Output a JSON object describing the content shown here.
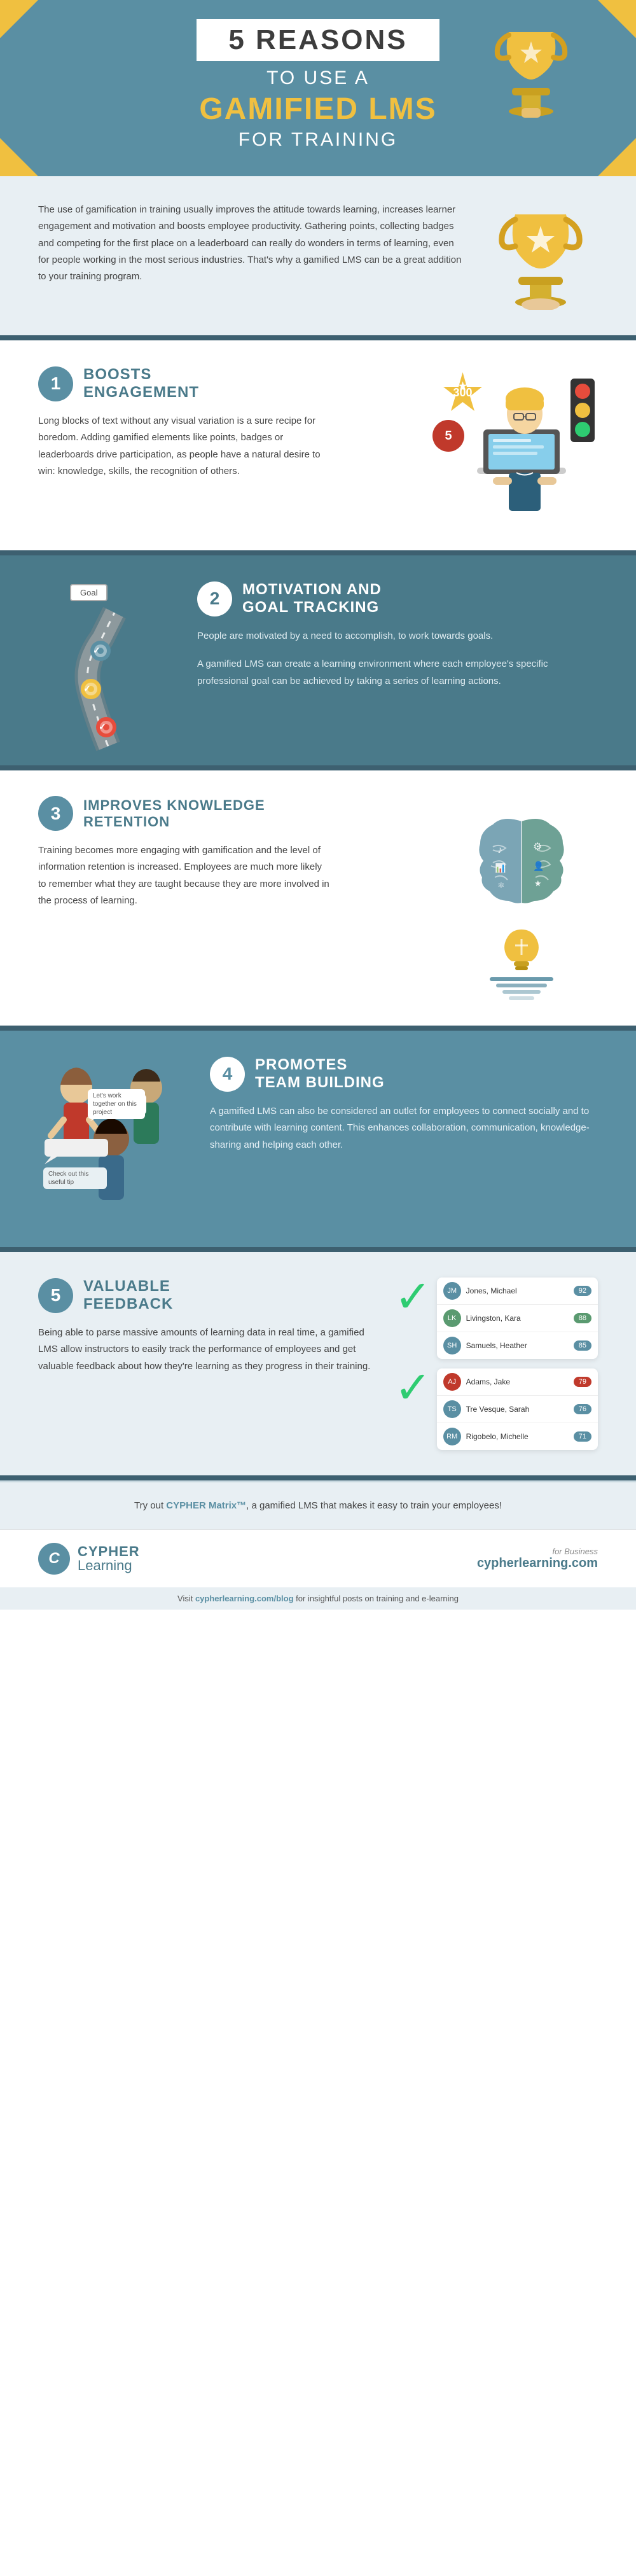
{
  "header": {
    "banner_text": "5 REASONS",
    "sub1": "TO USE A",
    "sub2": "GAMIFIED LMS",
    "sub3": "FOR TRAINING"
  },
  "intro": {
    "text": "The use of gamification in training usually improves the attitude towards learning, increases learner engagement and motivation and boosts employee productivity. Gathering points, collecting badges and competing for the first place on a leaderboard can really do wonders in terms of learning, even for people working in the most serious industries. That's why a gamified LMS can be a great addition to your training program."
  },
  "reasons": [
    {
      "number": "1",
      "title": "BOOSTS\nENGAGEMENT",
      "title_line1": "BOOSTS",
      "title_line2": "ENGAGEMENT",
      "body": "Long blocks of text without any visual variation is a sure recipe for boredom. Adding gamified elements like points, badges or leaderboards drive participation, as people have a natural desire to win: knowledge, skills, the recognition of others.",
      "badge_300": "300",
      "badge_5": "5"
    },
    {
      "number": "2",
      "title_line1": "MOTIVATION AND",
      "title_line2": "GOAL TRACKING",
      "body1": "People are motivated by a need to accomplish, to work towards goals.",
      "body2": "A gamified LMS can create a learning environment where each employee's specific professional goal can be achieved by taking a series of learning actions.",
      "goal_label": "Goal"
    },
    {
      "number": "3",
      "title_line1": "IMPROVES KNOWLEDGE",
      "title_line2": "RETENTION",
      "body": "Training becomes more engaging with gamification and the level of information retention is increased. Employees are much more likely to remember what they are taught because they are more involved in the process of learning."
    },
    {
      "number": "4",
      "title_line1": "PROMOTES",
      "title_line2": "TEAM BUILDING",
      "body": "A gamified LMS can also be considered an outlet for employees to connect socially and to contribute with learning content. This enhances collaboration, communication, knowledge-sharing and helping each other.",
      "bubble1": "Let's work together on this project",
      "bubble2": "Check out this useful tip"
    },
    {
      "number": "5",
      "title_line1": "VALUABLE",
      "title_line2": "FEEDBACK",
      "body": "Being able to parse massive amounts of learning data in real time, a gamified LMS allow instructors to easily track the performance of employees and get valuable feedback about how they're learning as they progress in their training.",
      "leaderboard": [
        {
          "name": "Jones, Michael",
          "score": "92",
          "color": "#5a8fa3"
        },
        {
          "name": "Livingston, Kara",
          "score": "88",
          "color": "#5a9a70"
        },
        {
          "name": "Samuels, Heather",
          "score": "85",
          "color": "#5a8fa3"
        }
      ],
      "leaderboard2": [
        {
          "name": "Adams, Jake",
          "score": "79",
          "color": "#c0392b"
        },
        {
          "name": "Tre Vesque, Sarah",
          "score": "76",
          "color": "#5a8fa3"
        },
        {
          "name": "Rigobelo, Michelle",
          "score": "71",
          "color": "#5a8fa3"
        }
      ]
    }
  ],
  "cta": {
    "text": "Try out CYPHER Matrix™, a gamified LMS that makes it easy to train your employees!"
  },
  "footer": {
    "brand": "CYPHER",
    "brand2": "Learning",
    "for_business": "for Business",
    "url": "cypherlearning.com",
    "visit_text": "Visit cypherlearning.com/blog for insightful posts on training and e-learning"
  }
}
